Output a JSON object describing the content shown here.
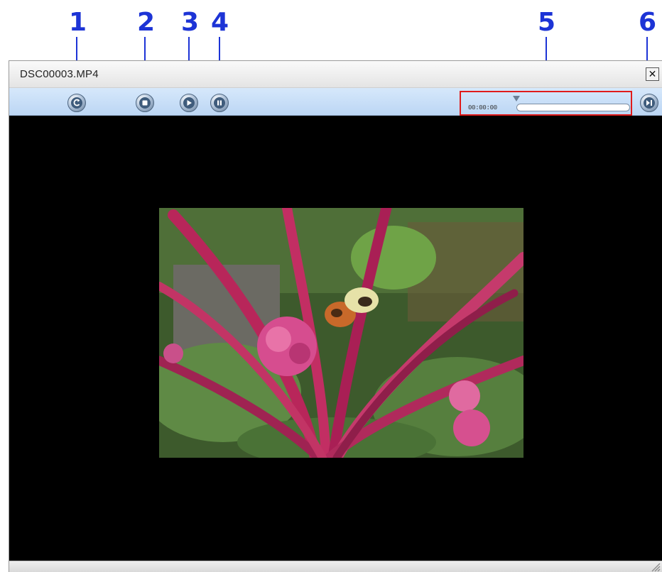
{
  "callouts": [
    "1",
    "2",
    "3",
    "4",
    "5",
    "6"
  ],
  "window": {
    "title": "DSC00003.MP4",
    "close_symbol": "✕"
  },
  "toolbar": {
    "buttons": [
      {
        "icon": "rewind-to-start-icon"
      },
      {
        "icon": "stop-icon"
      },
      {
        "icon": "play-icon"
      },
      {
        "icon": "pause-icon"
      }
    ],
    "seek": {
      "timecode": "00:00:00",
      "progress": 0
    },
    "right_button_icon": "frame-advance-icon"
  },
  "video": {
    "content": "flower-and-butterfly-photo"
  },
  "colors": {
    "callout": "#1d34d6",
    "highlight_box": "#e01b1b",
    "toolbar": "#c9dff7",
    "video_bg": "#000000"
  }
}
